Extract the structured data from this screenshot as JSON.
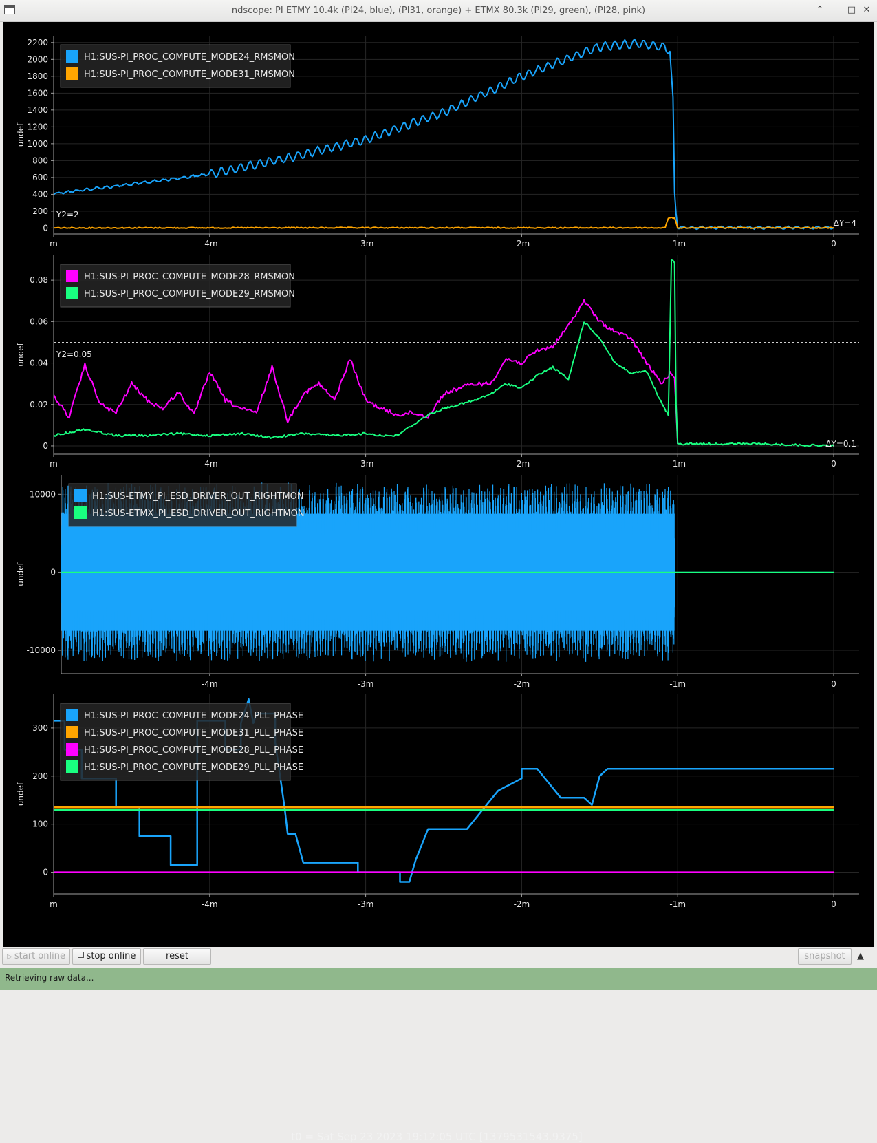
{
  "window": {
    "title": "ndscope: PI ETMY 10.4k (PI24, blue), (PI31, orange) + ETMX 80.3k (PI29, green), (PI28, pink)",
    "minimize_icon": "chevron-up-icon",
    "restore_icon": "underscore-icon",
    "maximize_icon": "square-icon",
    "close_icon": "close-icon"
  },
  "colors": {
    "blue": "#19a4fb",
    "orange": "#ffa500",
    "pink": "#ff00ff",
    "green": "#19ff80",
    "background": "#000000",
    "axis": "#a0a0a0",
    "grid": "#262626"
  },
  "xaxis": {
    "tick_values": [
      -5,
      -4,
      -3,
      -2,
      -1,
      0
    ],
    "tick_labels": [
      "m",
      "-4m",
      "-3m",
      "-2m",
      "-1m",
      "0"
    ]
  },
  "plots": [
    {
      "id": "p1",
      "ylabel": "undef",
      "ylim": [
        -70,
        2280
      ],
      "yticks": [
        0,
        200,
        400,
        600,
        800,
        1000,
        1200,
        1400,
        1600,
        1800,
        2000,
        2200
      ],
      "yticklabels": [
        "0",
        "200",
        "400",
        "600",
        "800",
        "1000",
        "1200",
        "1400",
        "1600",
        "1800",
        "2000",
        "2200"
      ],
      "cursor_label": "Y2=2",
      "delta_label": "ΔY=4",
      "legend": [
        {
          "label": "H1:SUS-PI_PROC_COMPUTE_MODE24_RMSMON",
          "color": "#19a4fb"
        },
        {
          "label": "H1:SUS-PI_PROC_COMPUTE_MODE31_RMSMON",
          "color": "#ffa500"
        }
      ]
    },
    {
      "id": "p2",
      "ylabel": "undef",
      "ylim": [
        -0.004,
        0.092
      ],
      "yticks": [
        0,
        0.02,
        0.04,
        0.06,
        0.08
      ],
      "yticklabels": [
        "0",
        "0.02",
        "0.04",
        "0.06",
        "0.08"
      ],
      "cursor_label": "Y2=0.05",
      "delta_label": "ΔY=0.1",
      "legend": [
        {
          "label": "H1:SUS-PI_PROC_COMPUTE_MODE28_RMSMON",
          "color": "#ff00ff"
        },
        {
          "label": "H1:SUS-PI_PROC_COMPUTE_MODE29_RMSMON",
          "color": "#19ff80"
        }
      ]
    },
    {
      "id": "p3",
      "ylabel": "undef",
      "ylim": [
        -13000,
        12500
      ],
      "yticks": [
        -10000,
        0,
        10000
      ],
      "yticklabels": [
        "-10000",
        "0",
        "10000"
      ],
      "legend": [
        {
          "label": "H1:SUS-ETMY_PI_ESD_DRIVER_OUT_RIGHTMON",
          "color": "#19a4fb"
        },
        {
          "label": "H1:SUS-ETMX_PI_ESD_DRIVER_OUT_RIGHTMON",
          "color": "#19ff80"
        }
      ]
    },
    {
      "id": "p4",
      "ylabel": "undef",
      "ylim": [
        -45,
        370
      ],
      "yticks": [
        0,
        100,
        200,
        300
      ],
      "yticklabels": [
        "0",
        "100",
        "200",
        "300"
      ],
      "legend": [
        {
          "label": "H1:SUS-PI_PROC_COMPUTE_MODE24_PLL_PHASE",
          "color": "#19a4fb"
        },
        {
          "label": "H1:SUS-PI_PROC_COMPUTE_MODE31_PLL_PHASE",
          "color": "#ffa500"
        },
        {
          "label": "H1:SUS-PI_PROC_COMPUTE_MODE28_PLL_PHASE",
          "color": "#ff00ff"
        },
        {
          "label": "H1:SUS-PI_PROC_COMPUTE_MODE29_PLL_PHASE",
          "color": "#19ff80"
        }
      ]
    }
  ],
  "t0_text": "t0 = Sat Sep 23 2023 19:12:05 UTC [1379531543.9375]",
  "chart_data": [
    {
      "type": "line",
      "ylabel": "undef",
      "x_unit": "minutes relative to t0",
      "ylim": [
        -70,
        2280
      ],
      "series": [
        {
          "name": "H1:SUS-PI_PROC_COMPUTE_MODE24_RMSMON",
          "color": "#19a4fb",
          "x": [
            -5.0,
            -4.5,
            -4.0,
            -3.5,
            -3.0,
            -2.5,
            -2.0,
            -1.5,
            -1.25,
            -1.1,
            -1.05,
            -1.03,
            -1.02,
            -1.0,
            -0.5,
            0.0
          ],
          "y": [
            410,
            520,
            640,
            830,
            1050,
            1370,
            1800,
            2150,
            2190,
            2150,
            2100,
            1500,
            400,
            5,
            5,
            5
          ]
        },
        {
          "name": "H1:SUS-PI_PROC_COMPUTE_MODE31_RMSMON",
          "color": "#ffa500",
          "x": [
            -5.0,
            -3.0,
            -1.08,
            -1.06,
            -1.02,
            -1.0,
            0.0
          ],
          "y": [
            2,
            3,
            3,
            120,
            120,
            3,
            3
          ]
        }
      ]
    },
    {
      "type": "line",
      "ylabel": "undef",
      "x_unit": "minutes relative to t0",
      "ylim": [
        -0.004,
        0.092
      ],
      "series": [
        {
          "name": "H1:SUS-PI_PROC_COMPUTE_MODE28_RMSMON",
          "color": "#ff00ff",
          "x": [
            -5.0,
            -4.9,
            -4.8,
            -4.7,
            -4.6,
            -4.5,
            -4.4,
            -4.3,
            -4.2,
            -4.1,
            -4.0,
            -3.9,
            -3.8,
            -3.7,
            -3.6,
            -3.5,
            -3.4,
            -3.3,
            -3.2,
            -3.1,
            -3.0,
            -2.9,
            -2.8,
            -2.7,
            -2.6,
            -2.5,
            -2.4,
            -2.3,
            -2.2,
            -2.1,
            -2.0,
            -1.9,
            -1.8,
            -1.7,
            -1.6,
            -1.5,
            -1.4,
            -1.3,
            -1.2,
            -1.1,
            -1.05,
            -1.02,
            -1.0
          ],
          "y": [
            0.024,
            0.014,
            0.039,
            0.02,
            0.016,
            0.03,
            0.022,
            0.018,
            0.026,
            0.015,
            0.036,
            0.022,
            0.018,
            0.016,
            0.038,
            0.012,
            0.025,
            0.03,
            0.022,
            0.042,
            0.022,
            0.018,
            0.015,
            0.016,
            0.014,
            0.025,
            0.028,
            0.03,
            0.03,
            0.042,
            0.04,
            0.046,
            0.048,
            0.058,
            0.07,
            0.06,
            0.055,
            0.052,
            0.04,
            0.03,
            0.035,
            0.032,
            0.001
          ]
        },
        {
          "name": "H1:SUS-PI_PROC_COMPUTE_MODE29_RMSMON",
          "color": "#19ff80",
          "x": [
            -5.0,
            -4.8,
            -4.6,
            -4.4,
            -4.2,
            -4.0,
            -3.8,
            -3.6,
            -3.4,
            -3.2,
            -3.0,
            -2.9,
            -2.8,
            -2.7,
            -2.6,
            -2.5,
            -2.4,
            -2.3,
            -2.2,
            -2.1,
            -2.0,
            -1.9,
            -1.8,
            -1.7,
            -1.6,
            -1.5,
            -1.4,
            -1.3,
            -1.2,
            -1.1,
            -1.06,
            -1.04,
            -1.02,
            -1.01,
            -1.0,
            -0.5,
            0.0
          ],
          "y": [
            0.005,
            0.008,
            0.005,
            0.005,
            0.006,
            0.005,
            0.006,
            0.004,
            0.006,
            0.005,
            0.006,
            0.005,
            0.005,
            0.01,
            0.015,
            0.018,
            0.02,
            0.022,
            0.025,
            0.03,
            0.028,
            0.034,
            0.038,
            0.032,
            0.06,
            0.052,
            0.04,
            0.035,
            0.036,
            0.02,
            0.015,
            0.09,
            0.088,
            0.02,
            0.001,
            0.001,
            0.0
          ]
        }
      ]
    },
    {
      "type": "line",
      "ylabel": "undef",
      "x_unit": "minutes relative to t0",
      "ylim": [
        -13000,
        12500
      ],
      "series": [
        {
          "name": "H1:SUS-ETMY_PI_ESD_DRIVER_OUT_RIGHTMON",
          "color": "#19a4fb",
          "x": [
            -4.95,
            -1.02
          ],
          "y_min": [
            -11500,
            -11500
          ],
          "y_max": [
            11500,
            11500
          ],
          "after_x": -1.02,
          "after_y": 0
        },
        {
          "name": "H1:SUS-ETMX_PI_ESD_DRIVER_OUT_RIGHTMON",
          "color": "#19ff80",
          "x": [
            -4.95,
            0.0
          ],
          "y": [
            0,
            0
          ]
        }
      ]
    },
    {
      "type": "line",
      "ylabel": "undef",
      "x_unit": "minutes relative to t0",
      "ylim": [
        -45,
        370
      ],
      "series": [
        {
          "name": "H1:SUS-PI_PROC_COMPUTE_MODE24_PLL_PHASE",
          "color": "#19a4fb",
          "x": [
            -5.0,
            -4.93,
            -4.93,
            -4.82,
            -4.82,
            -4.6,
            -4.6,
            -4.45,
            -4.45,
            -4.42,
            -4.42,
            -4.25,
            -4.25,
            -4.08,
            -4.08,
            -4.0,
            -3.9,
            -3.9,
            -3.8,
            -3.8,
            -3.75,
            -3.72,
            -3.7,
            -3.68,
            -3.58,
            -3.58,
            -3.52,
            -3.5,
            -3.45,
            -3.4,
            -3.4,
            -3.05,
            -3.05,
            -3.0,
            -2.78,
            -2.78,
            -2.72,
            -2.68,
            -2.6,
            -2.6,
            -2.35,
            -2.3,
            -2.25,
            -2.2,
            -2.15,
            -2.0,
            -2.0,
            -1.9,
            -1.9,
            -1.75,
            -1.75,
            -1.6,
            -1.55,
            -1.5,
            -1.45,
            -1.45,
            0.0
          ],
          "y": [
            315,
            315,
            255,
            255,
            195,
            195,
            135,
            135,
            75,
            75,
            75,
            75,
            15,
            15,
            315,
            315,
            315,
            255,
            255,
            310,
            360,
            310,
            330,
            330,
            330,
            270,
            135,
            80,
            80,
            20,
            20,
            20,
            0,
            0,
            0,
            -20,
            -20,
            25,
            90,
            90,
            90,
            110,
            130,
            150,
            170,
            195,
            215,
            215,
            215,
            155,
            155,
            155,
            140,
            200,
            215,
            215,
            215
          ]
        },
        {
          "name": "H1:SUS-PI_PROC_COMPUTE_MODE31_PLL_PHASE",
          "color": "#ffa500",
          "x": [
            -5.0,
            0.0
          ],
          "y": [
            135,
            135
          ]
        },
        {
          "name": "H1:SUS-PI_PROC_COMPUTE_MODE28_PLL_PHASE",
          "color": "#ff00ff",
          "x": [
            -5.0,
            0.0
          ],
          "y": [
            0,
            0
          ]
        },
        {
          "name": "H1:SUS-PI_PROC_COMPUTE_MODE29_PLL_PHASE",
          "color": "#19ff80",
          "x": [
            -5.0,
            0.0
          ],
          "y": [
            130,
            130
          ]
        }
      ]
    }
  ],
  "buttons": {
    "start_online": "start online",
    "stop_online": "stop online",
    "reset": "reset",
    "snapshot": "snapshot",
    "collapse_icon": "triangle-up-icon"
  },
  "status": {
    "text": "Retrieving raw data..."
  }
}
